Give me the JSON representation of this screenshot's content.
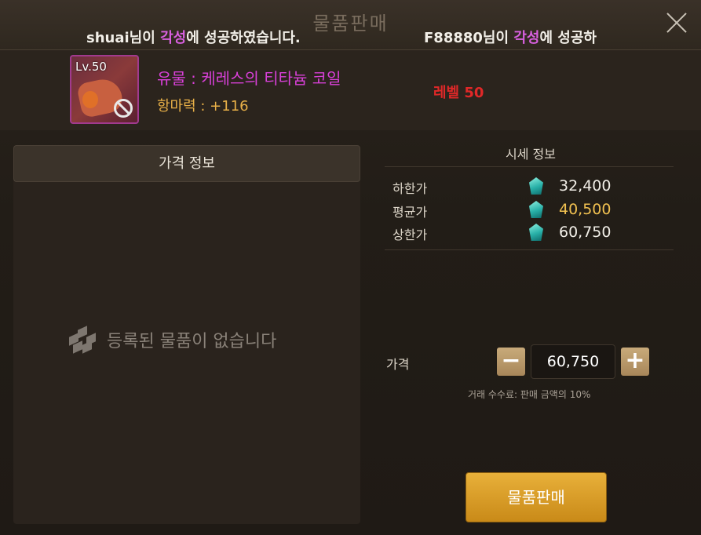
{
  "window": {
    "title": "물품판매"
  },
  "notices": [
    {
      "name": "shuai",
      "suffix": "님이 ",
      "highlight": "각성",
      "rest": "에 성공하였습니다."
    },
    {
      "name": "F88880",
      "suffix": "님이 ",
      "highlight": "각성",
      "rest": "에 성공하"
    }
  ],
  "item": {
    "level_badge": "Lv.50",
    "name": "유물 : 케레스의 티타늄 코일",
    "stat": "항마력 : +116",
    "level_text": "레벨 50"
  },
  "price_panel": {
    "header": "가격 정보",
    "empty_message": "등록된 물품이 없습니다"
  },
  "market": {
    "title": "시세 정보",
    "rows": [
      {
        "label": "하한가",
        "value": "32,400"
      },
      {
        "label": "평균가",
        "value": "40,500"
      },
      {
        "label": "상한가",
        "value": "60,750"
      }
    ]
  },
  "sell_form": {
    "price_label": "가격",
    "minus": "−",
    "plus": "+",
    "price_value": "60,750",
    "fee_text": "거래 수수료: 판매 금액의 10%",
    "sell_button": "물품판매"
  },
  "colors": {
    "highlight": "#d860e0",
    "item_name": "#d840d8",
    "stat": "#e8b048",
    "level": "#e02828",
    "average_price": "#f0c050",
    "sell_button": "#d89c28"
  }
}
